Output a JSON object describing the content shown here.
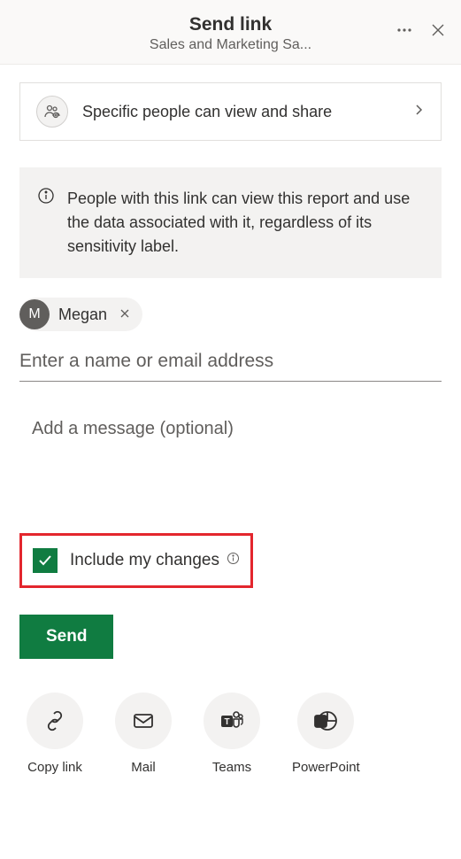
{
  "header": {
    "title": "Send link",
    "subtitle": "Sales and Marketing Sa..."
  },
  "linkSettings": {
    "label": "Specific people can view and share"
  },
  "infoBanner": {
    "text": "People with this link can view this report and use the data associated with it, regardless of its sensitivity label."
  },
  "recipients": [
    {
      "initial": "M",
      "name": "Megan"
    }
  ],
  "nameInput": {
    "placeholder": "Enter a name or email address"
  },
  "messageInput": {
    "placeholder": "Add a message (optional)"
  },
  "includeChanges": {
    "label": "Include my changes",
    "checked": true
  },
  "actions": {
    "sendLabel": "Send"
  },
  "shareOptions": [
    {
      "id": "copy-link",
      "label": "Copy link"
    },
    {
      "id": "mail",
      "label": "Mail"
    },
    {
      "id": "teams",
      "label": "Teams"
    },
    {
      "id": "powerpoint",
      "label": "PowerPoint"
    }
  ]
}
